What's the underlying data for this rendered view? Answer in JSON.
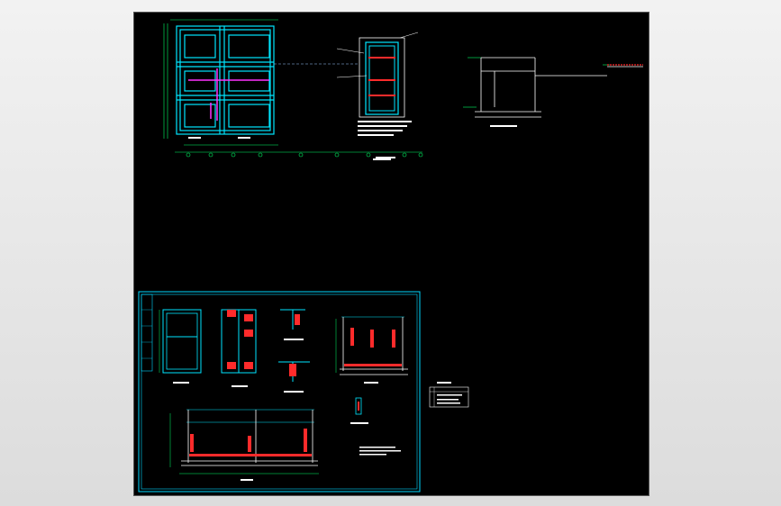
{
  "window": {
    "background": "#e8e8e8",
    "canvas_background": "#000000"
  },
  "colors": {
    "wall": "#00e5ff",
    "dim": "#00ff66",
    "rebar": "#ff2b2b",
    "highlight": "#ff33ff",
    "line": "#ffffff",
    "frame": "#00d8ff"
  },
  "drawing": {
    "sheets": [
      {
        "name": "plan-view"
      },
      {
        "name": "section-view"
      },
      {
        "name": "side-section"
      },
      {
        "name": "detail-sheet"
      }
    ]
  }
}
